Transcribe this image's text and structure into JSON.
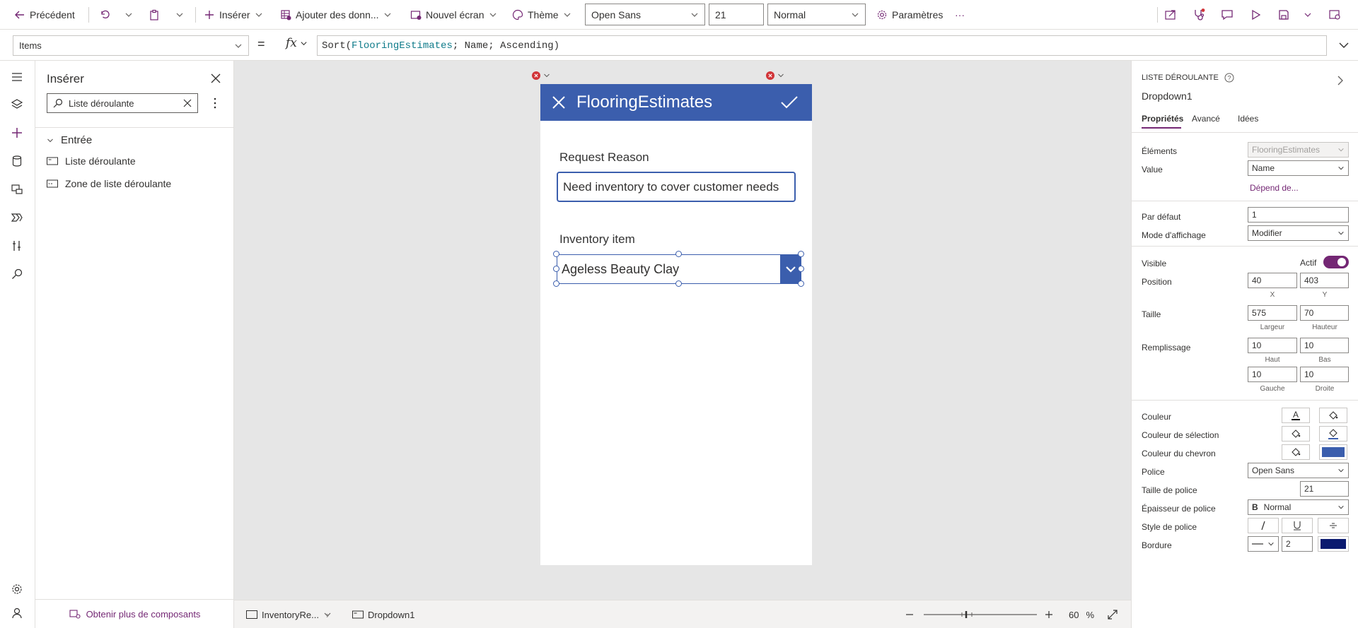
{
  "toolbar": {
    "back_label": "Précédent",
    "insert_label": "Insérer",
    "add_data_label": "Ajouter des donn...",
    "new_screen_label": "Nouvel écran",
    "theme_label": "Thème",
    "font_value": "Open Sans",
    "font_size_value": "21",
    "font_weight_value": "Normal",
    "settings_label": "Paramètres",
    "more_label": "···"
  },
  "formula": {
    "property": "Items",
    "equals": "=",
    "fx": "fx",
    "expression_parts": [
      {
        "text": "Sort(",
        "color": "#323130"
      },
      {
        "text": "FlooringEstimates",
        "color": "#0f7b8a"
      },
      {
        "text": "; Name; Ascending)",
        "color": "#323130"
      }
    ]
  },
  "insert_pane": {
    "title": "Insérer",
    "search_value": "Liste déroulante",
    "section_label": "Entrée",
    "items": [
      "Liste déroulante",
      "Zone de liste déroulante"
    ],
    "footer_link": "Obtenir plus de composants"
  },
  "app": {
    "title": "FlooringEstimates",
    "reason_label": "Request Reason",
    "reason_value": "Need inventory to cover customer needs",
    "item_label": "Inventory item",
    "dropdown_value": "Ageless Beauty Clay",
    "header_color": "#3b5ead"
  },
  "statusbar": {
    "screen_name": "InventoryRe...",
    "control_name": "Dropdown1",
    "zoom_value": "60",
    "zoom_unit": "%"
  },
  "props": {
    "type_label": "LISTE DÉROULANTE",
    "control_name": "Dropdown1",
    "tabs": [
      "Propriétés",
      "Avancé",
      "Idées"
    ],
    "items_label": "Éléments",
    "items_value": "FlooringEstimates",
    "value_label": "Value",
    "value_value": "Name",
    "depends_link": "Dépend de...",
    "default_label": "Par défaut",
    "default_value": "1",
    "display_mode_label": "Mode d'affichage",
    "display_mode_value": "Modifier",
    "visible_label": "Visible",
    "visible_state": "Actif",
    "position_label": "Position",
    "pos_x": "40",
    "pos_y": "403",
    "pos_x_sub": "X",
    "pos_y_sub": "Y",
    "size_label": "Taille",
    "width": "575",
    "height": "70",
    "width_sub": "Largeur",
    "height_sub": "Hauteur",
    "padding_label": "Remplissage",
    "pad_top": "10",
    "pad_bottom": "10",
    "pad_left": "10",
    "pad_right": "10",
    "pad_top_sub": "Haut",
    "pad_bottom_sub": "Bas",
    "pad_left_sub": "Gauche",
    "pad_right_sub": "Droite",
    "color_label": "Couleur",
    "selection_color_label": "Couleur de sélection",
    "chevron_color_label": "Couleur du chevron",
    "font_label": "Police",
    "font_value": "Open Sans",
    "font_size_label": "Taille de police",
    "font_size_value": "21",
    "font_weight_label": "Épaisseur de police",
    "font_weight_value": "Normal",
    "font_weight_prefix": "B",
    "font_style_label": "Style de police",
    "border_label": "Bordure",
    "border_width": "2",
    "accent_color": "#742774",
    "chevron_fill_color": "#3b5ead",
    "border_color": "#0b1a6f"
  }
}
